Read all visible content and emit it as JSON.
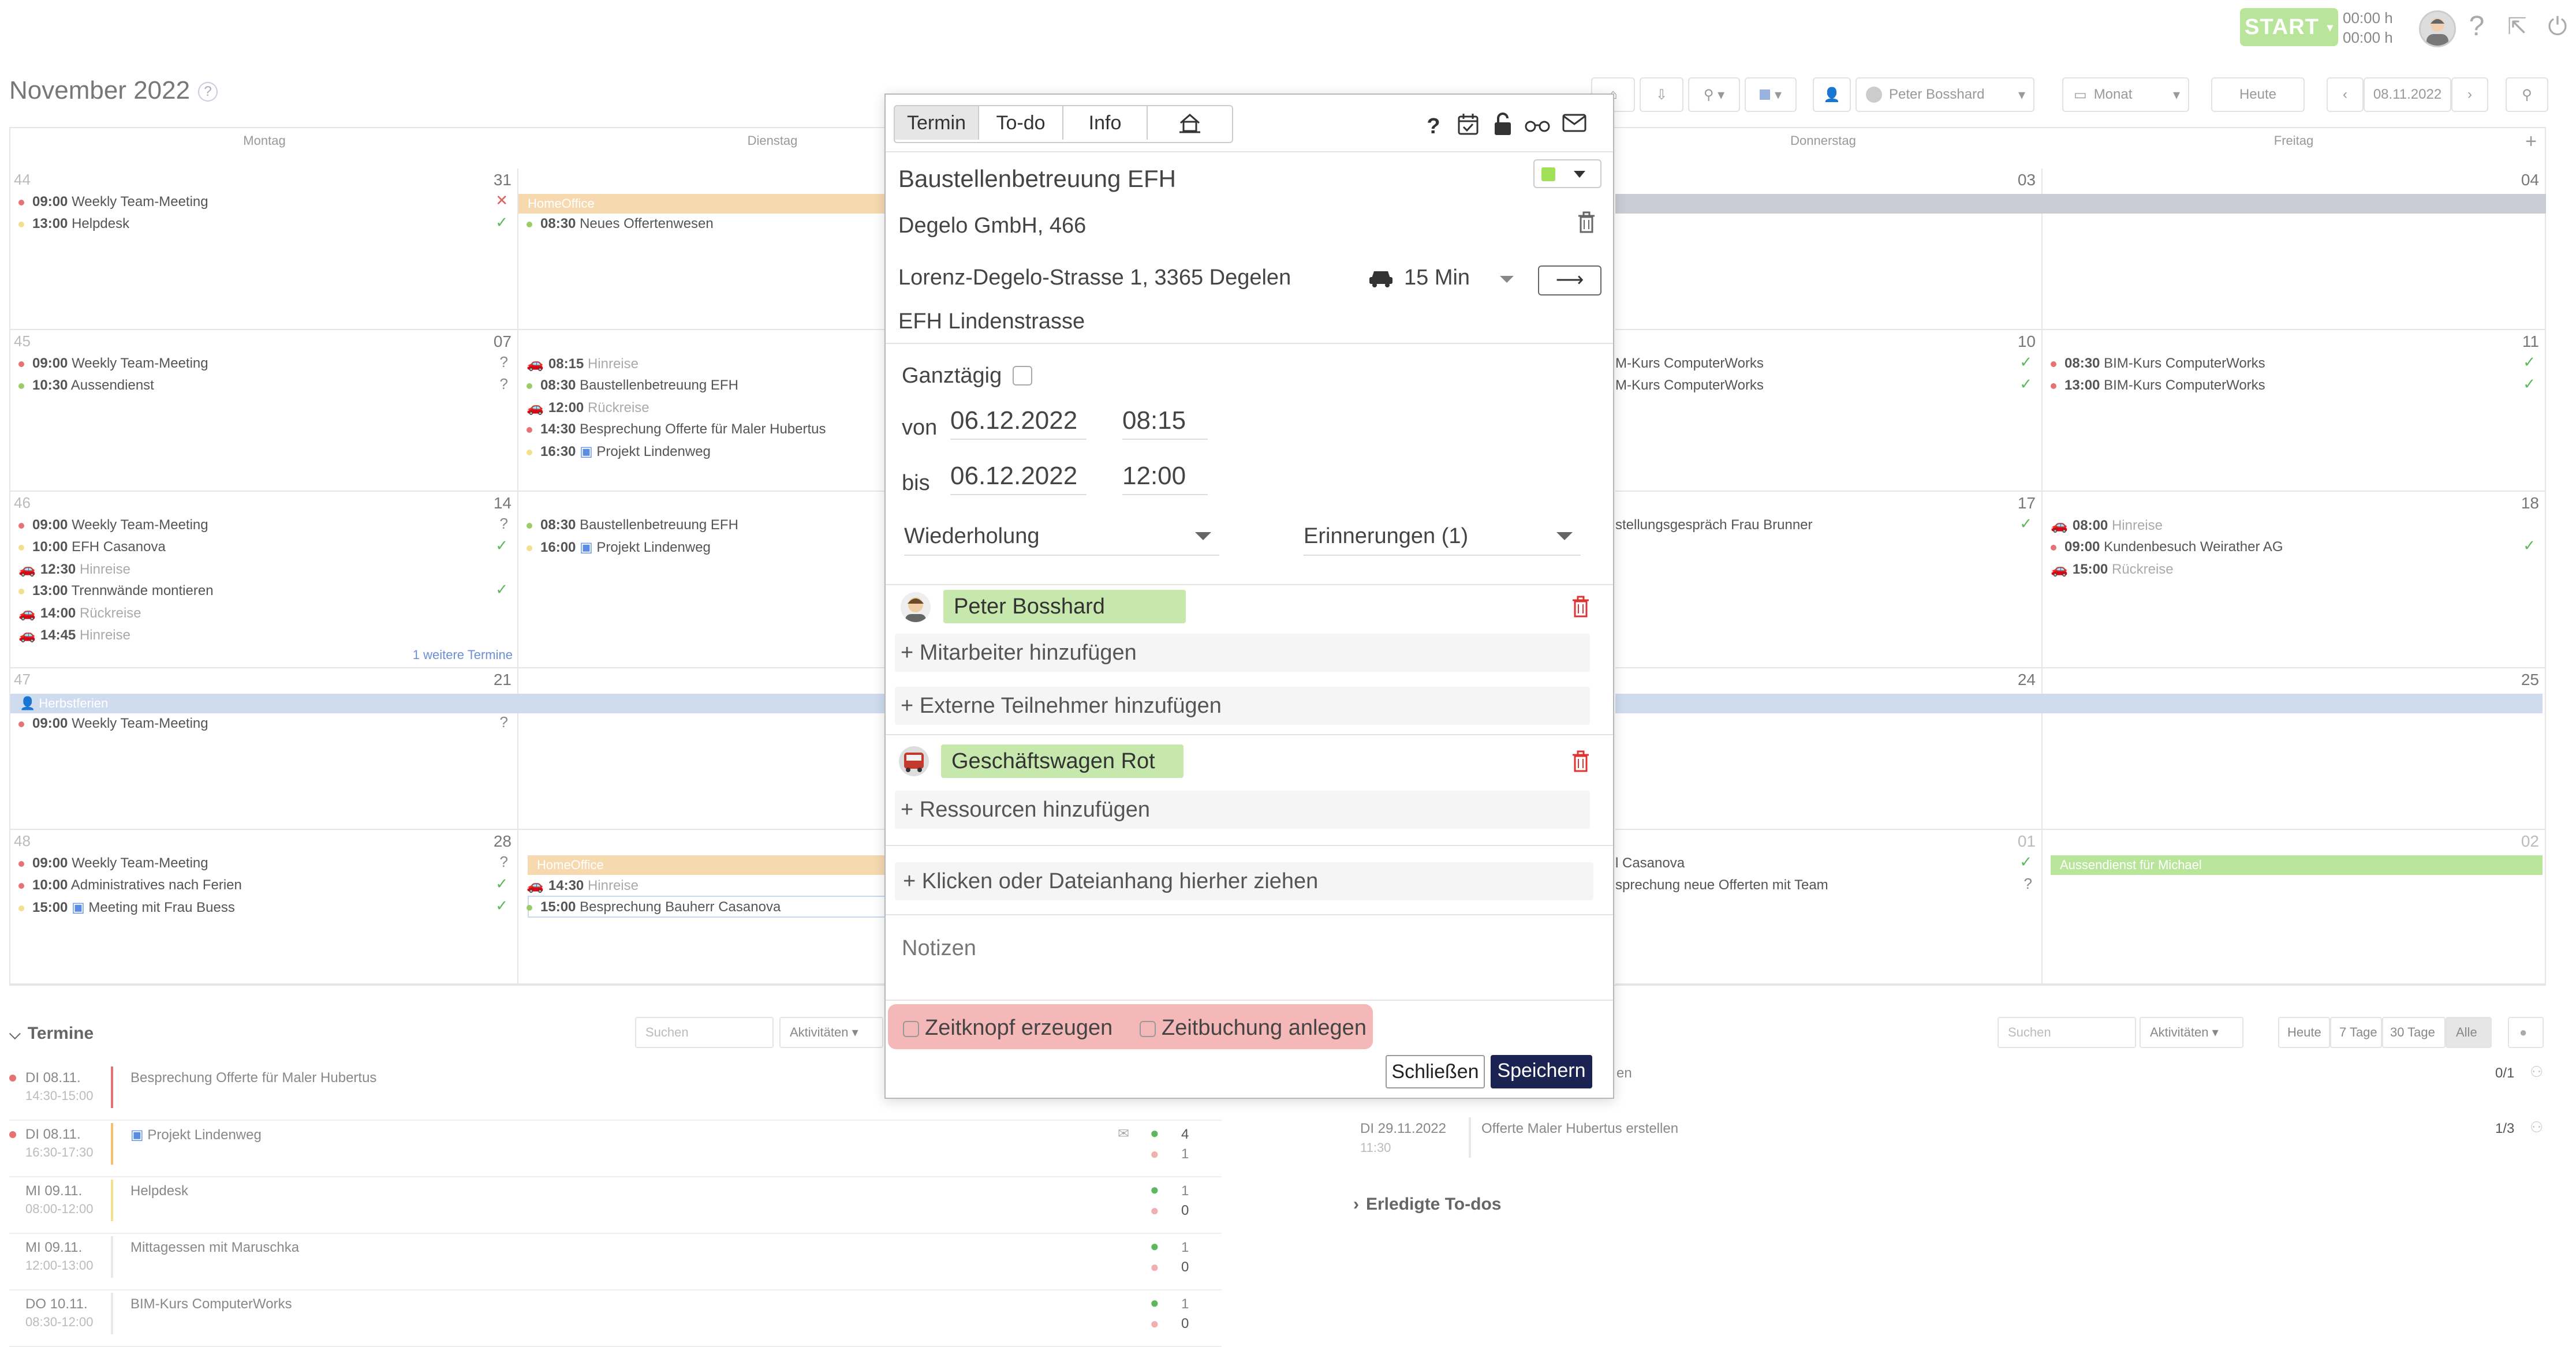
{
  "topbar": {
    "start_label": "START",
    "timer_1": "00:00 h",
    "timer_2": "00:00 h"
  },
  "calendar": {
    "title": "November 2022",
    "user_filter": "Peter Bosshard",
    "view": "Monat",
    "today_btn": "Heute",
    "date": "08.11.2022",
    "days": [
      "Montag",
      "Dienstag",
      "Donnerstag",
      "Freitag"
    ],
    "weeks": [
      {
        "kw": "44",
        "mon": {
          "num": "31",
          "events": [
            {
              "time": "09:00",
              "text": "Weekly Team-Meeting",
              "status": "✕"
            },
            {
              "time": "13:00",
              "text": "Helpdesk",
              "status": "✓"
            }
          ]
        },
        "tue": {
          "bar": "HomeOffice",
          "events": [
            {
              "time": "08:30",
              "text": "Neues Offertenwesen"
            }
          ]
        },
        "thu": {
          "num": "03"
        },
        "fri": {
          "num": "04"
        }
      },
      {
        "kw": "45",
        "mon": {
          "num": "07",
          "events": [
            {
              "time": "09:00",
              "text": "Weekly Team-Meeting",
              "status": "?"
            },
            {
              "time": "10:30",
              "text": "Aussendienst",
              "status": "?"
            }
          ]
        },
        "tue": {
          "events": [
            {
              "time": "08:15",
              "text": "Hinreise"
            },
            {
              "time": "08:30",
              "text": "Baustellenbetreuung EFH"
            },
            {
              "time": "12:00",
              "text": "Rückreise"
            },
            {
              "time": "14:30",
              "text": "Besprechung Offerte für Maler Hubertus"
            },
            {
              "time": "16:30",
              "text": "Projekt Lindenweg"
            }
          ]
        },
        "thu": {
          "num": "10",
          "events": [
            {
              "text": "M-Kurs ComputerWorks"
            },
            {
              "text": "M-Kurs ComputerWorks"
            }
          ]
        },
        "fri": {
          "num": "11",
          "events": [
            {
              "time": "08:30",
              "text": "BIM-Kurs ComputerWorks"
            },
            {
              "time": "13:00",
              "text": "BIM-Kurs ComputerWorks"
            }
          ]
        }
      },
      {
        "kw": "46",
        "mon": {
          "num": "14",
          "events": [
            {
              "time": "09:00",
              "text": "Weekly Team-Meeting",
              "status": "?"
            },
            {
              "time": "10:00",
              "text": "EFH Casanova",
              "status": "✓"
            },
            {
              "time": "12:30",
              "text": "Hinreise"
            },
            {
              "time": "13:00",
              "text": "Trennwände montieren",
              "status": "✓"
            },
            {
              "time": "14:00",
              "text": "Rückreise"
            },
            {
              "time": "14:45",
              "text": "Hinreise"
            }
          ],
          "more": "1 weitere Termine"
        },
        "tue": {
          "events": [
            {
              "time": "08:30",
              "text": "Baustellenbetreuung EFH"
            },
            {
              "time": "16:00",
              "text": "Projekt Lindenweg"
            }
          ]
        },
        "thu": {
          "num": "17",
          "events": [
            {
              "text": "stellungsgespräch Frau Brunner"
            }
          ]
        },
        "fri": {
          "num": "18",
          "events": [
            {
              "time": "08:00",
              "text": "Hinreise"
            },
            {
              "time": "09:00",
              "text": "Kundenbesuch Weirather AG"
            },
            {
              "time": "15:00",
              "text": "Rückreise"
            }
          ]
        }
      },
      {
        "kw": "47",
        "mon": {
          "num": "21",
          "bar": "Herbstferien",
          "events": [
            {
              "time": "09:00",
              "text": "Weekly Team-Meeting",
              "status": "?"
            }
          ]
        },
        "thu": {
          "num": "24"
        },
        "fri": {
          "num": "25"
        }
      },
      {
        "kw": "48",
        "mon": {
          "num": "28",
          "events": [
            {
              "time": "09:00",
              "text": "Weekly Team-Meeting",
              "status": "?"
            },
            {
              "time": "10:00",
              "text": "Administratives nach Ferien",
              "status": "✓"
            },
            {
              "time": "15:00",
              "text": "Meeting mit Frau Buess",
              "status": "✓"
            }
          ]
        },
        "tue": {
          "bar": "HomeOffice",
          "events": [
            {
              "time": "14:30",
              "text": "Hinreise"
            },
            {
              "time": "15:00",
              "text": "Besprechung Bauherr Casanova"
            }
          ]
        },
        "thu": {
          "num": "01",
          "events": [
            {
              "text": "l Casanova"
            },
            {
              "text": "sprechung neue Offerten mit Team"
            }
          ]
        },
        "fri": {
          "num": "02",
          "bar": "Aussendienst für Michael"
        }
      }
    ]
  },
  "termine": {
    "title": "Termine",
    "search_placeholder": "Suchen",
    "filter": "Aktivitäten",
    "rows": [
      {
        "date": "DI 08.11.",
        "time": "14:30-15:00",
        "name": "Besprechung Offerte für Maler Hubertus"
      },
      {
        "date": "DI 08.11.",
        "time": "16:30-17:30",
        "name": "Projekt Lindenweg",
        "count_a": "4",
        "count_b": "1"
      },
      {
        "date": "MI 09.11.",
        "time": "08:00-12:00",
        "name": "Helpdesk",
        "count_a": "1",
        "count_b": "0"
      },
      {
        "date": "MI 09.11.",
        "time": "12:00-13:00",
        "name": "Mittagessen mit Maruschka",
        "count_a": "1",
        "count_b": "0"
      },
      {
        "date": "DO 10.11.",
        "time": "08:30-12:00",
        "name": "BIM-Kurs ComputerWorks",
        "count_a": "1",
        "count_b": "0"
      }
    ]
  },
  "todos": {
    "search_placeholder": "Suchen",
    "filter": "Aktivitäten",
    "ranges": [
      "Heute",
      "7 Tage",
      "30 Tage",
      "Alle"
    ],
    "row1_fragment": "en",
    "row1_count": "0/1",
    "row2_date": "DI 29.11.2022",
    "row2_time": "11:30",
    "row2_name": "Offerte Maler Hubertus erstellen",
    "row2_count": "1/3",
    "done_title": "Erledigte To-dos"
  },
  "modal": {
    "tabs": [
      "Termin",
      "To-do",
      "Info"
    ],
    "title": "Baustellenbetreuung EFH",
    "color": "#a3e05a",
    "company": "Degelo GmbH, 466",
    "address": "Lorenz-Degelo-Strasse 1, 3365 Degelen",
    "travel": "15 Min",
    "project": "EFH Lindenstrasse",
    "allday_label": "Ganztägig",
    "from_label": "von",
    "from_date": "06.12.2022",
    "from_time": "08:15",
    "to_label": "bis",
    "to_date": "06.12.2022",
    "to_time": "12:00",
    "repeat_label": "Wiederholung",
    "reminder_label": "Erinnerungen (1)",
    "participant": "Peter Bosshard",
    "add_employee": "+ Mitarbeiter hinzufügen",
    "add_external": "+ Externe Teilnehmer hinzufügen",
    "resource": "Geschäftswagen Rot",
    "add_resource": "+ Ressourcen hinzufügen",
    "attach": "+ Klicken oder Dateianhang hierher ziehen",
    "notes_placeholder": "Notizen",
    "zeitknopf": "Zeitknopf erzeugen",
    "zeitbuchung": "Zeitbuchung anlegen",
    "close": "Schließen",
    "save": "Speichern"
  },
  "colors": {
    "homeoffice": "#f7d9b0",
    "herbstferien": "#cfdcf0",
    "aussendienst": "#b9e59b",
    "green_check": "#5cb85c",
    "red": "#d9534f",
    "save_btn": "#1a2352",
    "highlight": "#f5b8b8"
  }
}
